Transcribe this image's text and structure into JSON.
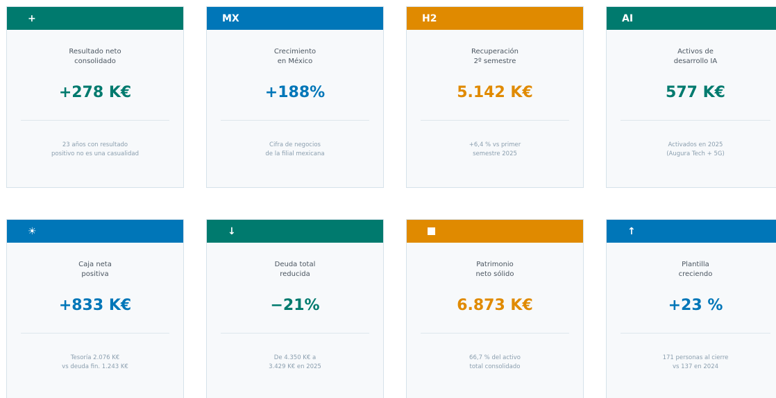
{
  "colors": {
    "teal": "#007a6e",
    "blue": "#0076b8",
    "orange": "#e08a00"
  },
  "cards": [
    {
      "badge": "+",
      "badge_icon": "plus-icon",
      "color": "teal",
      "label": "Resultado neto\nconsolidado",
      "value": "+278 K€",
      "note": "23 años con resultado\npositivo no es una casualidad"
    },
    {
      "badge": "MX",
      "color": "blue",
      "label": "Crecimiento\nen México",
      "value": "+188%",
      "note": "Cifra de negocios\nde la filial mexicana"
    },
    {
      "badge": "H2",
      "color": "orange",
      "label": "Recuperación\n2º semestre",
      "value": "5.142 K€",
      "note": "+6,4 % vs primer\nsemestre 2025"
    },
    {
      "badge": "AI",
      "color": "teal",
      "label": "Activos de\ndesarrollo IA",
      "value": "577 K€",
      "note": "Activados en 2025\n(Augura Tech + 5G)"
    },
    {
      "badge": "☀",
      "badge_icon": "sun-icon",
      "color": "blue",
      "label": "Caja neta\npositiva",
      "value": "+833 K€",
      "note": "Tesoría 2.076 K€\nvs deuda fin. 1.243 K€"
    },
    {
      "badge": "↓",
      "badge_icon": "arrow-down-icon",
      "color": "teal",
      "label": "Deuda total\nreducida",
      "value": "−21%",
      "note": "De 4.350 K€ a\n3.429 K€ en 2025"
    },
    {
      "badge": "",
      "badge_icon": "square-icon",
      "color": "orange",
      "label": "Patrimonio\nneto sólido",
      "value": "6.873 K€",
      "note": "66,7 % del activo\ntotal consolidado"
    },
    {
      "badge": "↑",
      "badge_icon": "arrow-up-icon",
      "color": "blue",
      "label": "Plantilla\ncreciendo",
      "value": "+23 %",
      "note": "171 personas al cierre\nvs 137 en 2024"
    }
  ]
}
